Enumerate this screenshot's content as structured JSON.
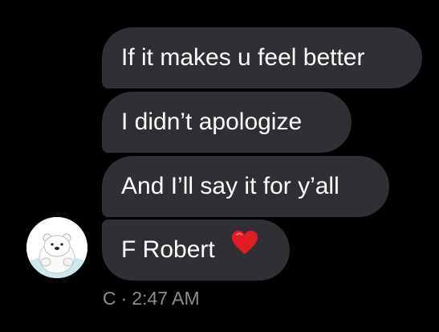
{
  "messages": [
    {
      "text": "If it makes u feel better"
    },
    {
      "text": "I didn’t apologize"
    },
    {
      "text": "And I’ll say it for y’all"
    },
    {
      "text": "F Robert",
      "emoji": "heart-icon"
    }
  ],
  "sender": {
    "name": "C",
    "separator": "·",
    "time": "2:47 AM",
    "avatar_icon": "polar-bear-avatar-icon"
  },
  "colors": {
    "background": "#000000",
    "bubble": "#2f3033",
    "text": "#ffffff",
    "meta": "#8d8d8f",
    "heart": "#e31b23"
  }
}
